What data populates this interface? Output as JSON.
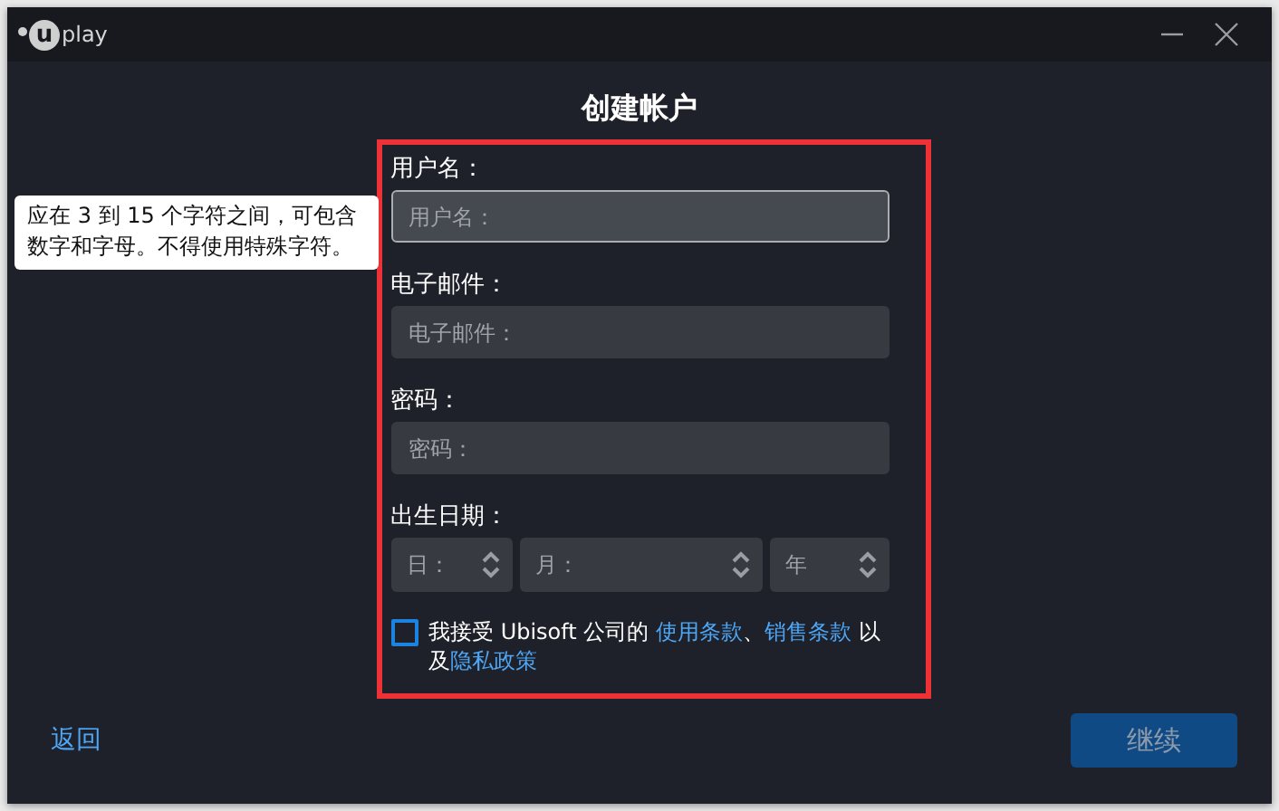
{
  "window": {
    "logo": {
      "mark": "u",
      "text": "play"
    },
    "title": "创建帐户"
  },
  "tooltip": "应在 3 到 15 个字符之间，可包含数字和字母。不得使用特殊字符。",
  "form": {
    "fields": [
      {
        "label": "用户名：",
        "placeholder": "用户名：",
        "focused": true
      },
      {
        "label": "电子邮件：",
        "placeholder": "电子邮件：",
        "focused": false
      },
      {
        "label": "密码：",
        "placeholder": "密码：",
        "focused": false
      }
    ],
    "birth_date": {
      "label": "出生日期：",
      "selects": [
        {
          "placeholder": "日："
        },
        {
          "placeholder": "月："
        },
        {
          "placeholder": "年"
        }
      ]
    },
    "terms": {
      "checked": false,
      "parts": [
        {
          "kind": "text",
          "text": "我接受 Ubisoft 公司的 "
        },
        {
          "kind": "link",
          "text": "使用条款"
        },
        {
          "kind": "text",
          "text": "、"
        },
        {
          "kind": "link",
          "text": "销售条款"
        },
        {
          "kind": "text",
          "text": " 以及"
        },
        {
          "kind": "link",
          "text": "隐私政策"
        }
      ]
    }
  },
  "footer": {
    "back": "返回",
    "continue": {
      "label": "继续",
      "disabled": true
    }
  }
}
